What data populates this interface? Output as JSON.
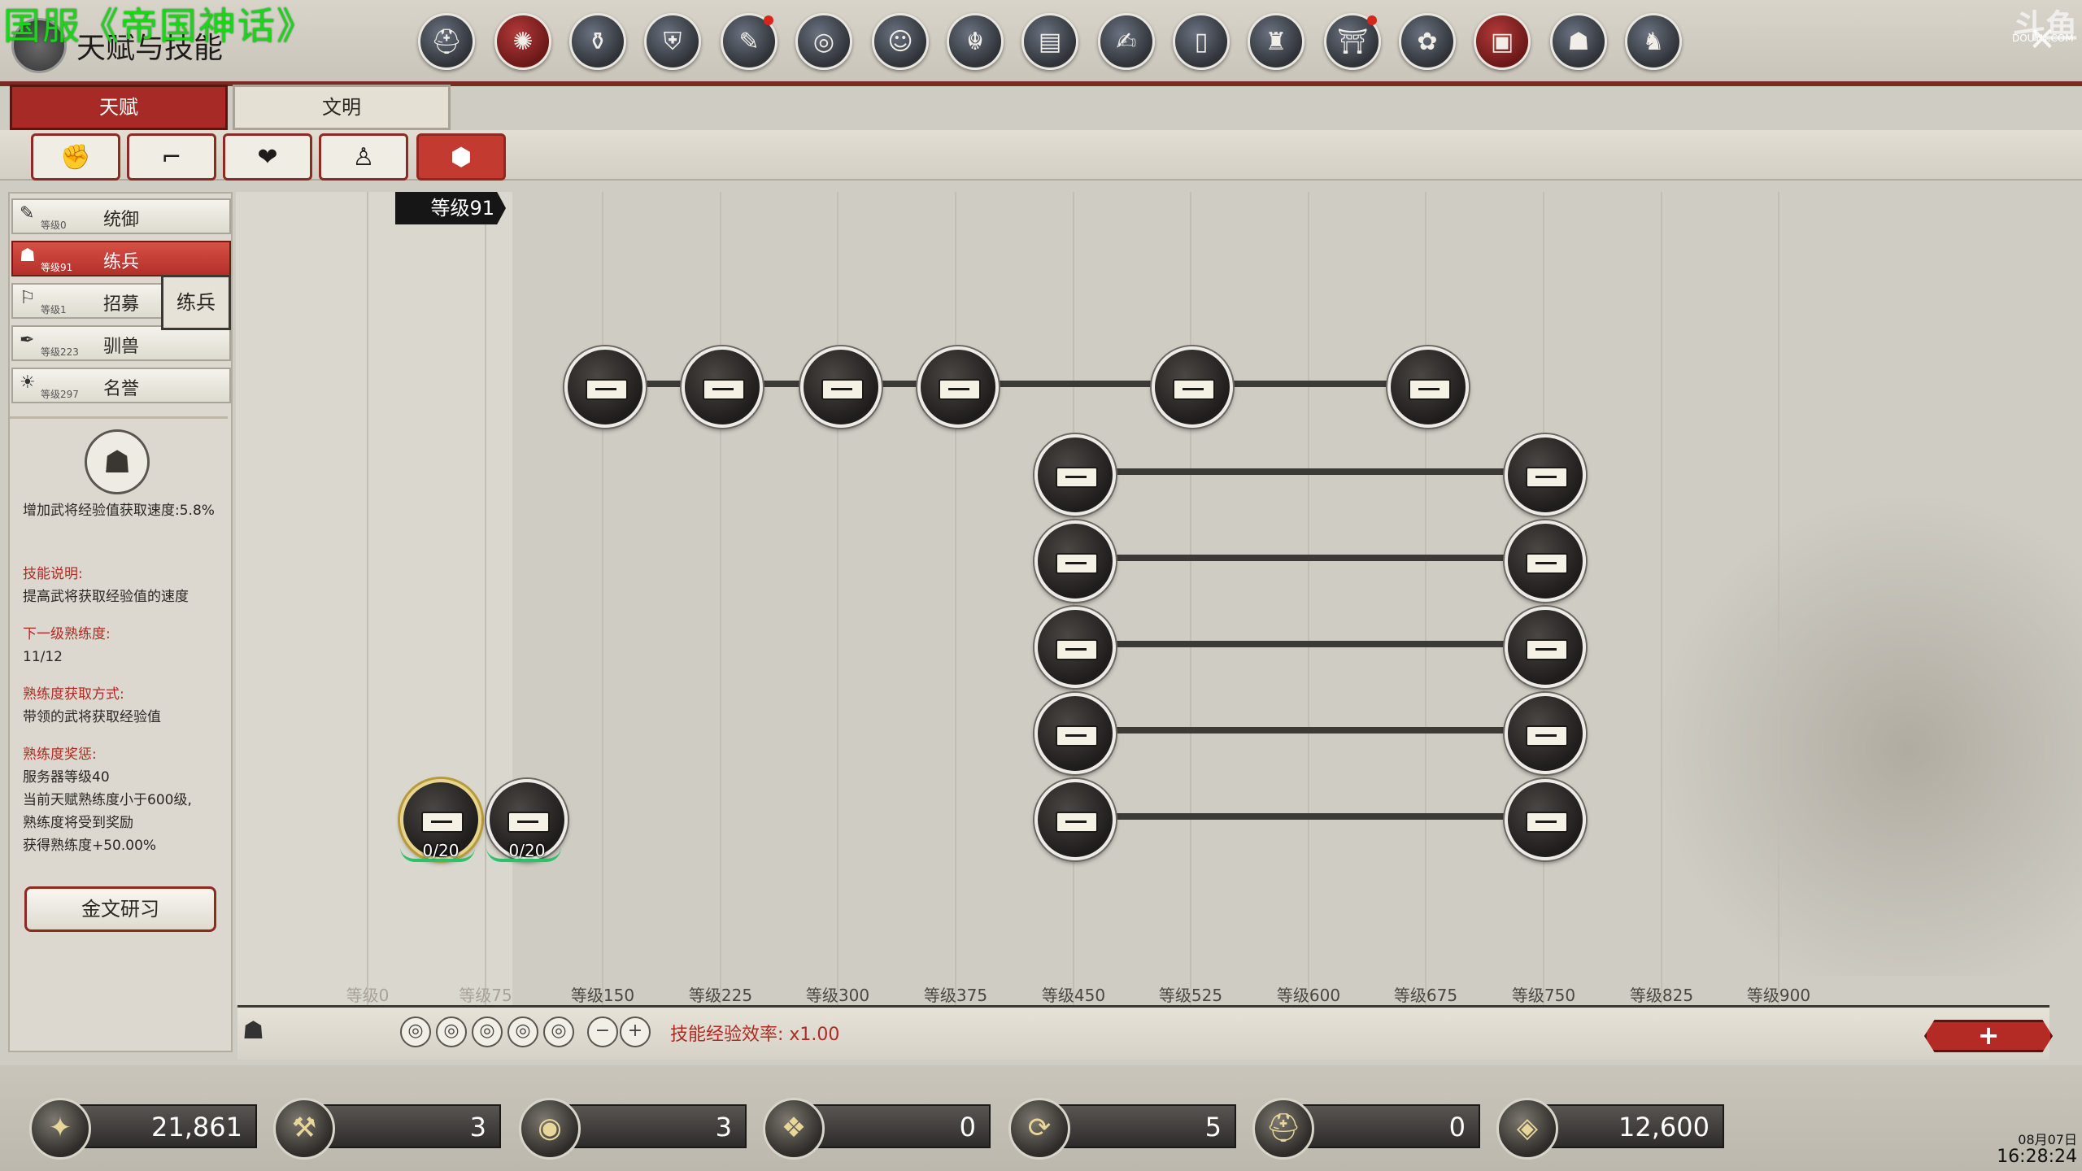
{
  "stream_title": "国服《帝国神话》",
  "window": {
    "title": "天赋与技能",
    "close_icon": "close-icon"
  },
  "watermark": {
    "text": "斗鱼",
    "sub": "DOUYU.COM"
  },
  "top_icons": [
    {
      "name": "helmet-icon",
      "glyph": "⛑"
    },
    {
      "name": "skill-wheel-icon",
      "glyph": "✺",
      "active": true
    },
    {
      "name": "pot-icon",
      "glyph": "⚱"
    },
    {
      "name": "shield-icon",
      "glyph": "⛨"
    },
    {
      "name": "scroll-icon",
      "glyph": "✎",
      "dot": true
    },
    {
      "name": "coin-icon",
      "glyph": "◎"
    },
    {
      "name": "face-icon",
      "glyph": "☺"
    },
    {
      "name": "dragon-icon",
      "glyph": "☬"
    },
    {
      "name": "book-icon",
      "glyph": "▤"
    },
    {
      "name": "writing-icon",
      "glyph": "✍"
    },
    {
      "name": "door-icon",
      "glyph": "▯"
    },
    {
      "name": "building-icon",
      "glyph": "♜"
    },
    {
      "name": "altar-icon",
      "glyph": "⛩",
      "dot": true
    },
    {
      "name": "flower-icon",
      "glyph": "✿"
    },
    {
      "name": "chest-icon",
      "glyph": "▣",
      "active": true
    },
    {
      "name": "mask-icon",
      "glyph": "☗"
    },
    {
      "name": "horse-icon",
      "glyph": "♞"
    }
  ],
  "tabs": {
    "talent": "天赋",
    "civilization": "文明"
  },
  "subtabs": [
    {
      "name": "fist-icon",
      "glyph": "✊"
    },
    {
      "name": "boot-icon",
      "glyph": "⌐"
    },
    {
      "name": "heart-icon",
      "glyph": "❤"
    },
    {
      "name": "person-icon",
      "glyph": "♙"
    },
    {
      "name": "badge-icon",
      "glyph": "⬢",
      "active": true
    }
  ],
  "categories": [
    {
      "name": "统御",
      "level": "等级0",
      "glyph": "✎"
    },
    {
      "name": "练兵",
      "level": "等级91",
      "glyph": "☗",
      "active": true
    },
    {
      "name": "招募",
      "level": "等级1",
      "glyph": "⚐"
    },
    {
      "name": "驯兽",
      "level": "等级223",
      "glyph": "✒"
    },
    {
      "name": "名誉",
      "level": "等级297",
      "glyph": "☀"
    }
  ],
  "tooltip": "练兵",
  "detail": {
    "emblem": "☗",
    "effect": "增加武将经验值获取速度:5.8%",
    "desc_title": "技能说明:",
    "desc": "提高武将获取经验值的速度",
    "next_title": "下一级熟练度:",
    "next_value": "11/12",
    "gain_title": "熟练度获取方式:",
    "gain_value": "带领的武将获取经验值",
    "reward_title": "熟练度奖惩:",
    "reward_lines": [
      "服务器等级40",
      "当前天赋熟练度小于600级,",
      "熟练度将受到奖励",
      "获得熟练度+50.00%"
    ]
  },
  "study_button": "金文研习",
  "level_badge": "等级91",
  "start_nodes": [
    {
      "count": "0/20",
      "gold": true
    },
    {
      "count": "0/20",
      "gold": false
    }
  ],
  "axis_labels": [
    {
      "text": "等级0",
      "dim": true
    },
    {
      "text": "等级75",
      "dim": true
    },
    {
      "text": "等级150"
    },
    {
      "text": "等级225"
    },
    {
      "text": "等级300"
    },
    {
      "text": "等级375"
    },
    {
      "text": "等级450"
    },
    {
      "text": "等级525"
    },
    {
      "text": "等级600"
    },
    {
      "text": "等级675"
    },
    {
      "text": "等级750"
    },
    {
      "text": "等级825"
    },
    {
      "text": "等级900"
    }
  ],
  "exp_bar": {
    "rate": "技能经验效率: x1.00",
    "minus": "−",
    "plus": "+",
    "add_button": "+"
  },
  "resources": [
    {
      "name": "silver-icon",
      "glyph": "✦",
      "value": "21,861"
    },
    {
      "name": "hammer-icon",
      "glyph": "⚒",
      "value": "3"
    },
    {
      "name": "gold-coin-icon",
      "glyph": "◉",
      "value": "3"
    },
    {
      "name": "gems-icon",
      "glyph": "❖",
      "value": "0"
    },
    {
      "name": "refresh-icon",
      "glyph": "⟳",
      "value": "5"
    },
    {
      "name": "helm-token-icon",
      "glyph": "⛑",
      "value": "0"
    },
    {
      "name": "crystal-icon",
      "glyph": "◈",
      "value": "12,600"
    }
  ],
  "clock": {
    "date": "08月07日",
    "time": "16:28:24"
  }
}
